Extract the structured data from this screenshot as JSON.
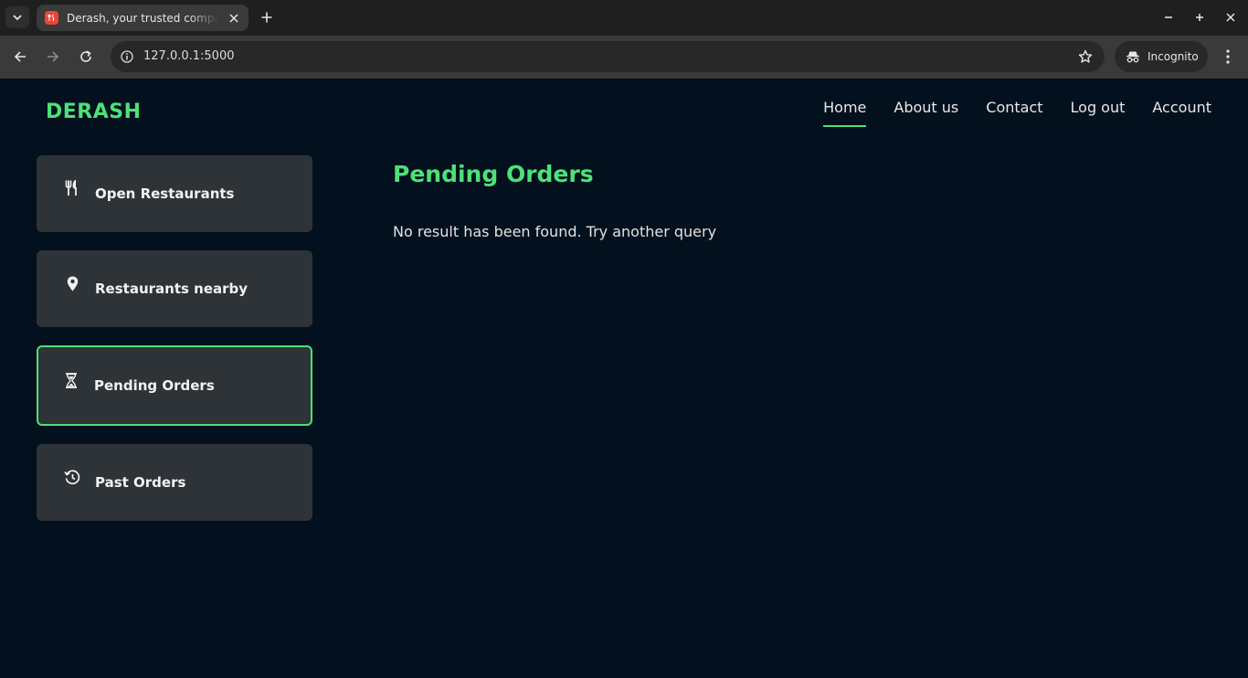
{
  "browser": {
    "tab_title": "Derash, your trusted companion",
    "url": "127.0.0.1:5000",
    "incognito_label": "Incognito"
  },
  "header": {
    "brand": "DERASH",
    "nav": [
      {
        "label": "Home",
        "active": true
      },
      {
        "label": "About us",
        "active": false
      },
      {
        "label": "Contact",
        "active": false
      },
      {
        "label": "Log out",
        "active": false
      },
      {
        "label": "Account",
        "active": false
      }
    ]
  },
  "sidebar": {
    "items": [
      {
        "label": "Open Restaurants",
        "icon": "utensils-icon",
        "active": false
      },
      {
        "label": "Restaurants nearby",
        "icon": "map-pin-icon",
        "active": false
      },
      {
        "label": "Pending Orders",
        "icon": "hourglass-icon",
        "active": true
      },
      {
        "label": "Past Orders",
        "icon": "history-icon",
        "active": false
      }
    ]
  },
  "main": {
    "title": "Pending Orders",
    "empty_message": "No result has been found. Try another query"
  },
  "colors": {
    "accent": "#4ee079",
    "background": "#02111d",
    "card": "#2e3338"
  }
}
